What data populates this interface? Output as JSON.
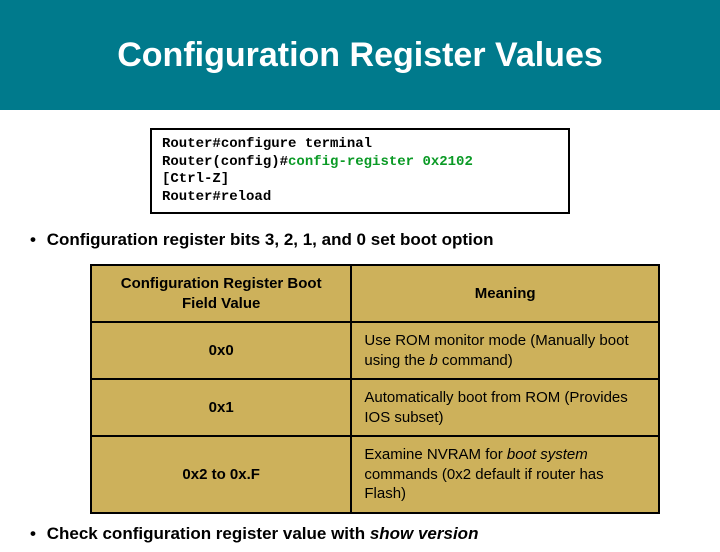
{
  "title": "Configuration Register Values",
  "terminal": {
    "line1_prefix": "Router#",
    "line1_cmd": "configure terminal",
    "line2_prefix": "Router(config)#",
    "line2_cmd": "config-register 0x2102",
    "line3": "[Ctrl-Z]",
    "line4_prefix": "Router#",
    "line4_cmd": "reload"
  },
  "bullet1": "Configuration register bits 3, 2, 1, and 0 set boot option",
  "table": {
    "head_left": "Configuration Register Boot Field Value",
    "head_right": "Meaning",
    "rows": [
      {
        "value": "0x0",
        "meaning_pre": "Use ROM monitor mode (Manually boot using the ",
        "meaning_em": "b",
        "meaning_post": " command)"
      },
      {
        "value": "0x1",
        "meaning_pre": "Automatically boot from ROM (Provides IOS subset)",
        "meaning_em": "",
        "meaning_post": ""
      },
      {
        "value": "0x2 to 0x.F",
        "meaning_pre": "Examine NVRAM for ",
        "meaning_em": "boot system",
        "meaning_post": " commands (0x2 default if router has Flash)"
      }
    ]
  },
  "bullet2_pre": "Check configuration register value with ",
  "bullet2_em": "show version"
}
